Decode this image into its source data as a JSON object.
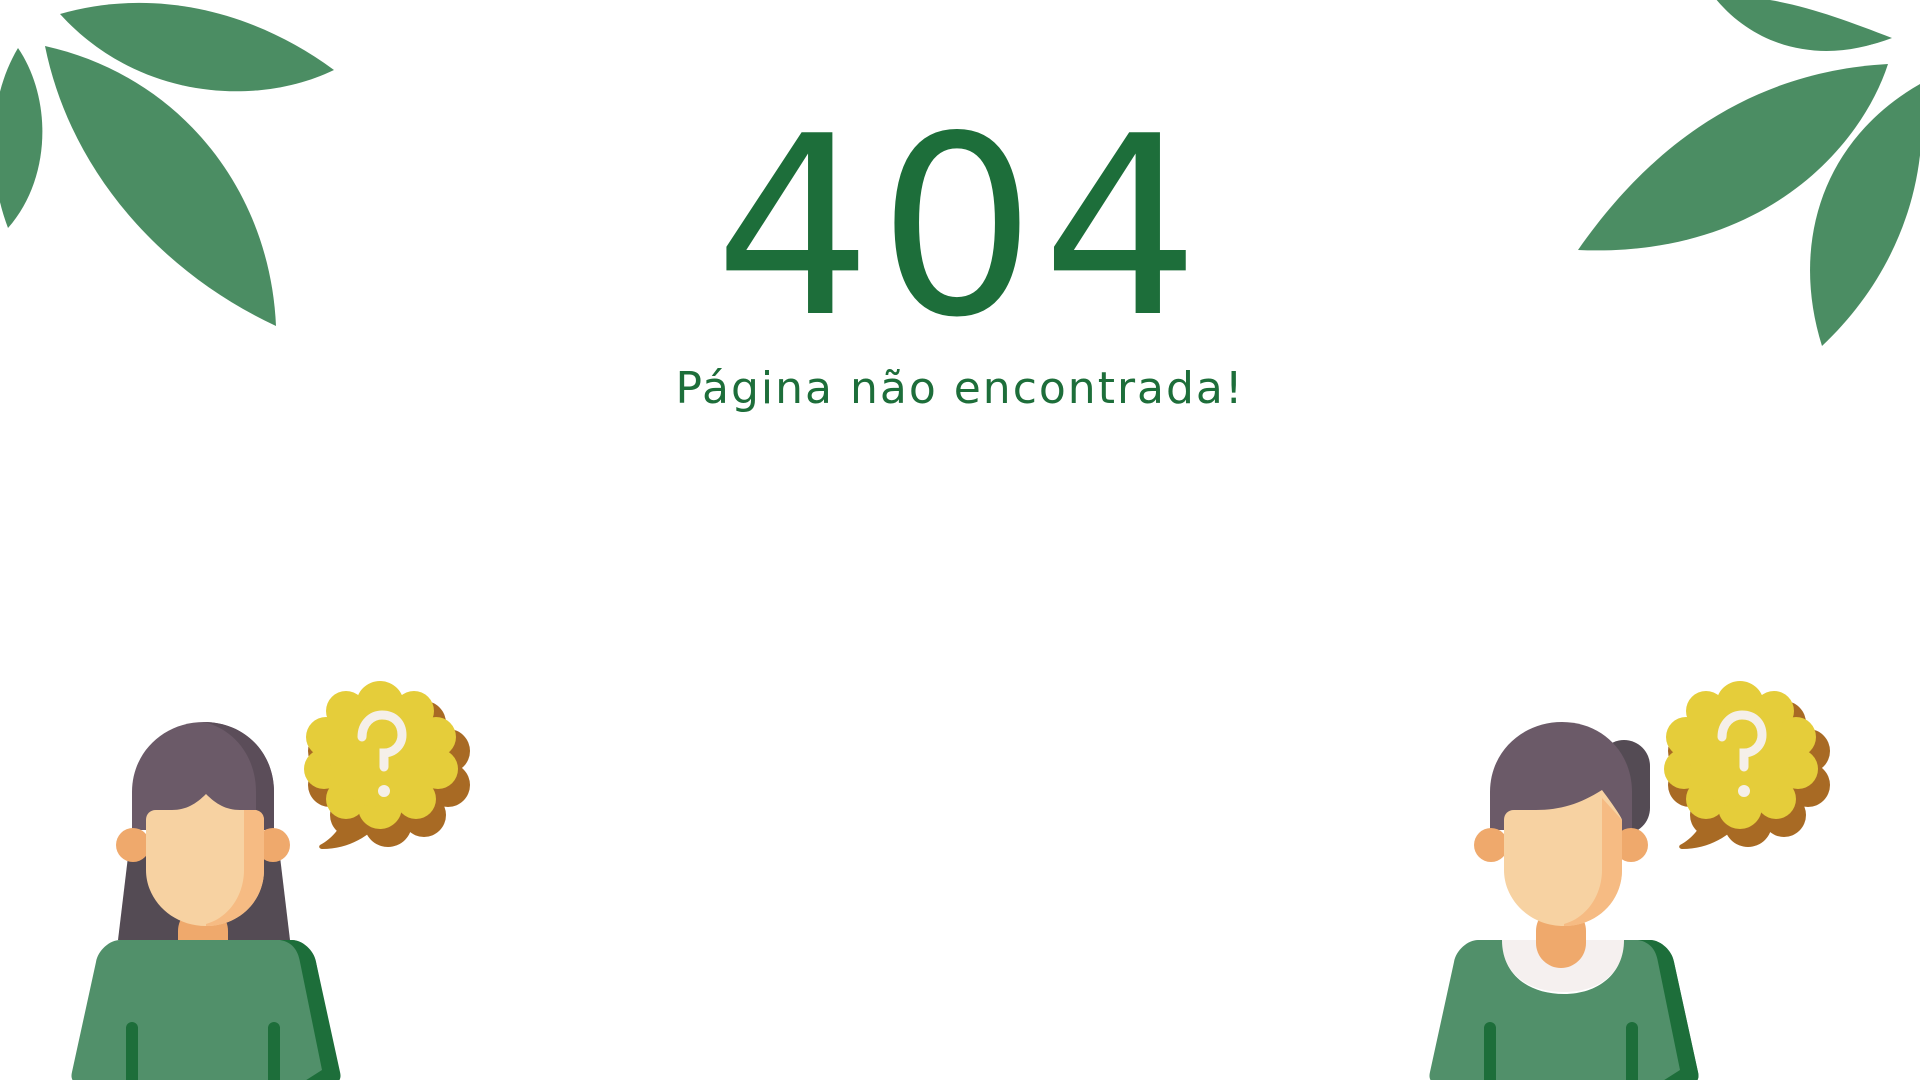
{
  "error": {
    "code": "404",
    "message": "Página não encontrada!"
  },
  "colors": {
    "brand_dark_green": "#1d6e3a",
    "leaf_green": "#4b8d63",
    "shirt_green": "#51906a",
    "hair_purple": "#6b5a68",
    "hair_dark": "#544b54",
    "skin_light": "#f7d2a2",
    "skin_shade": "#f6bb83",
    "ear_orange": "#efa96c",
    "bubble_yellow": "#e5cd3a",
    "bubble_shadow": "#a86a24",
    "question_mark": "#f5efe9",
    "collar_white": "#f5f0ef"
  },
  "icons": {
    "leaves_top_left": "leaf-cluster-icon",
    "leaves_top_right": "leaf-cluster-icon",
    "confused_woman": "confused-person-icon",
    "confused_man": "confused-person-icon",
    "thought_bubble": "question-thought-bubble-icon"
  }
}
